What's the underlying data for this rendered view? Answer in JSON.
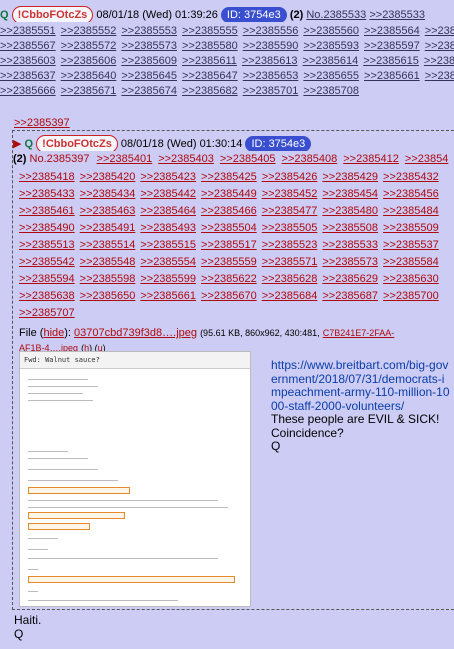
{
  "post1": {
    "q": "Q",
    "trip": "!CbboFOtcZs",
    "date": "08/01/18 (Wed) 01:39:26",
    "id": "ID: 3754e3",
    "reply_count": "(2)",
    "number": "No.2385533",
    "backlink_rows": [
      [
        ">>2385533"
      ],
      [
        ">>2385551",
        ">>2385552",
        ">>2385553",
        ">>2385555",
        ">>2385556",
        ">>2385560",
        ">>2385564",
        ">>2385"
      ],
      [
        ">>2385567",
        ">>2385572",
        ">>2385573",
        ">>2385580",
        ">>2385590",
        ">>2385593",
        ">>2385597",
        ">>2385"
      ],
      [
        ">>2385603",
        ">>2385606",
        ">>2385609",
        ">>2385611",
        ">>2385613",
        ">>2385614",
        ">>2385615",
        ">>2385"
      ],
      [
        ">>2385637",
        ">>2385640",
        ">>2385645",
        ">>2385647",
        ">>2385653",
        ">>2385655",
        ">>2385661",
        ">>2385"
      ],
      [
        ">>2385666",
        ">>2385671",
        ">>2385674",
        ">>2385682",
        ">>2385701",
        ">>2385708"
      ]
    ]
  },
  "reply_ref": ">>2385397",
  "post2": {
    "q": "Q",
    "trip": "!CbboFOtcZs",
    "date": "08/01/18 (Wed) 01:30:14",
    "id": "ID: 3754e3",
    "reply_count": "(2)",
    "number": "No.2385397",
    "first_links": [
      ">>2385401",
      ">>2385403",
      ">>2385405",
      ">>2385408",
      ">>2385412",
      ">>23854"
    ],
    "backlink_rows": [
      [
        ">>2385418",
        ">>2385420",
        ">>2385423",
        ">>2385425",
        ">>2385426",
        ">>2385429",
        ">>2385432"
      ],
      [
        ">>2385433",
        ">>2385434",
        ">>2385442",
        ">>2385449",
        ">>2385452",
        ">>2385454",
        ">>2385456"
      ],
      [
        ">>2385461",
        ">>2385463",
        ">>2385464",
        ">>2385466",
        ">>2385477",
        ">>2385480",
        ">>2385484"
      ],
      [
        ">>2385490",
        ">>2385491",
        ">>2385493",
        ">>2385504",
        ">>2385505",
        ">>2385508",
        ">>2385509"
      ],
      [
        ">>2385513",
        ">>2385514",
        ">>2385515",
        ">>2385517",
        ">>2385523",
        ">>2385533",
        ">>2385537"
      ],
      [
        ">>2385542",
        ">>2385548",
        ">>2385554",
        ">>2385559",
        ">>2385571",
        ">>2385573",
        ">>2385584"
      ],
      [
        ">>2385594",
        ">>2385598",
        ">>2385599",
        ">>2385622",
        ">>2385628",
        ">>2385629",
        ">>2385630"
      ],
      [
        ">>2385638",
        ">>2385650",
        ">>2385661",
        ">>2385670",
        ">>2385684",
        ">>2385687",
        ">>2385700"
      ],
      [
        ">>2385707"
      ]
    ],
    "file_label": "File",
    "hide_label": "hide",
    "file_name": "03707cbd739f3d8….jpeg",
    "file_info": "(95.61 KB, 860x962, 430:481,",
    "file_hash": "C7B241E7-2FAA-",
    "file_hash_2": "AF1B-4….jpeg",
    "h_label": "h",
    "u_label": "u",
    "thumb_title": "Fwd: Walnut sauce?",
    "body_link": "https://www.breitbart.com/big-government/2018/07/31/democrats-impeachment-army-110-million-1000-staff-2000-volunteers/",
    "body_lines": [
      "These people are EVIL & SICK!",
      "Coincidence?",
      "Q"
    ]
  },
  "bottom_lines": [
    "Haiti.",
    "Q"
  ]
}
